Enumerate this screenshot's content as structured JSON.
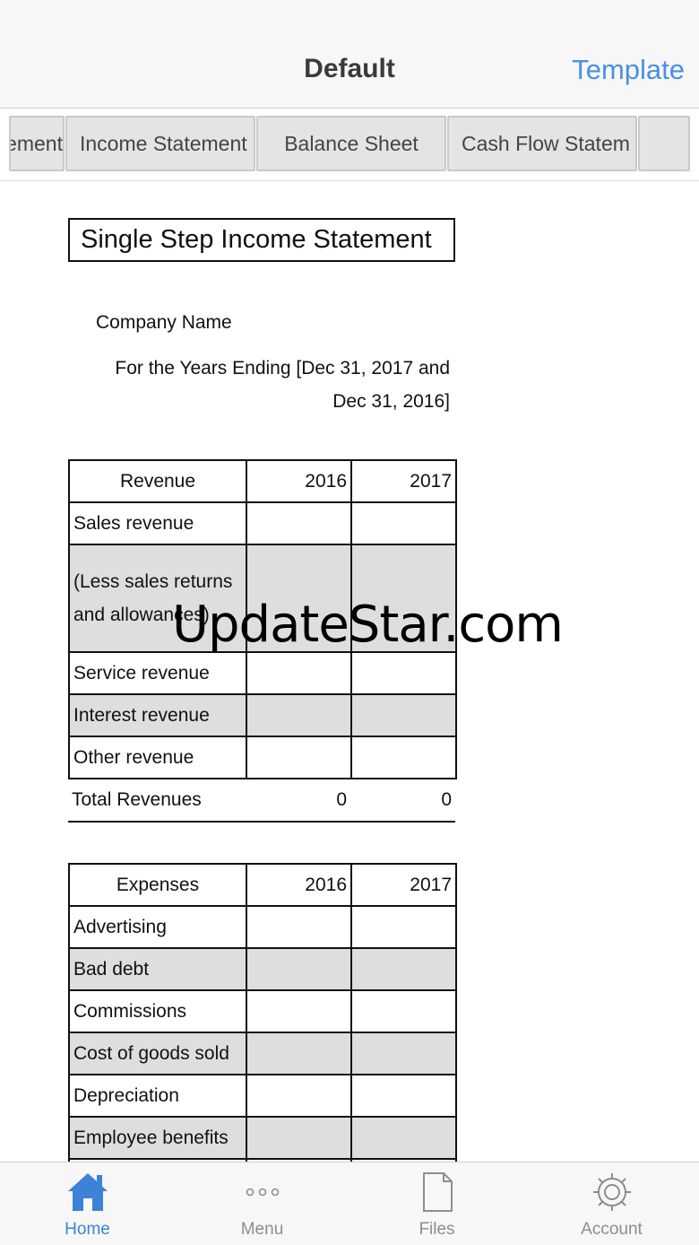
{
  "navbar": {
    "title": "Default",
    "action": "Template"
  },
  "tabs": [
    {
      "label": "ement"
    },
    {
      "label": "Income Statement"
    },
    {
      "label": "Balance Sheet"
    },
    {
      "label": "Cash Flow Statem"
    },
    {
      "label": ""
    }
  ],
  "sheet": {
    "title": "Single Step Income Statement",
    "company": "Company Name",
    "period_line1": "For the Years Ending [Dec 31, 2017 and",
    "period_line2": "Dec 31, 2016]"
  },
  "revenue": {
    "header": [
      "Revenue",
      "2016",
      "2017"
    ],
    "rows": [
      {
        "label": "Sales revenue",
        "v2016": "",
        "v2017": ""
      },
      {
        "label": "(Less sales returns and allowances)",
        "v2016": "",
        "v2017": ""
      },
      {
        "label": "Service revenue",
        "v2016": "",
        "v2017": ""
      },
      {
        "label": "Interest revenue",
        "v2016": "",
        "v2017": ""
      },
      {
        "label": "Other revenue",
        "v2016": "",
        "v2017": ""
      }
    ],
    "total": {
      "label": "Total Revenues",
      "v2016": "0",
      "v2017": "0"
    }
  },
  "expenses": {
    "header": [
      "Expenses",
      "2016",
      "2017"
    ],
    "rows": [
      {
        "label": "Advertising",
        "v2016": "",
        "v2017": ""
      },
      {
        "label": "Bad debt",
        "v2016": "",
        "v2017": ""
      },
      {
        "label": "Commissions",
        "v2016": "",
        "v2017": ""
      },
      {
        "label": "Cost of goods sold",
        "v2016": "",
        "v2017": ""
      },
      {
        "label": "Depreciation",
        "v2016": "",
        "v2017": ""
      },
      {
        "label": "Employee benefits",
        "v2016": "",
        "v2017": ""
      },
      {
        "label": "",
        "v2016": "",
        "v2017": ""
      }
    ]
  },
  "watermark": "UpdateStar.com",
  "tabbar": {
    "items": [
      {
        "label": "Home",
        "icon": "house-icon"
      },
      {
        "label": "Menu",
        "icon": "ellipsis-icon"
      },
      {
        "label": "Files",
        "icon": "document-icon"
      },
      {
        "label": "Account",
        "icon": "gear-icon"
      }
    ],
    "active_color": "#3b82d8",
    "inactive_color": "#8e8e8e"
  },
  "colors": {
    "accent": "#4a90e2",
    "shade": "#dedede",
    "tab_bg": "#e4e4e4"
  }
}
